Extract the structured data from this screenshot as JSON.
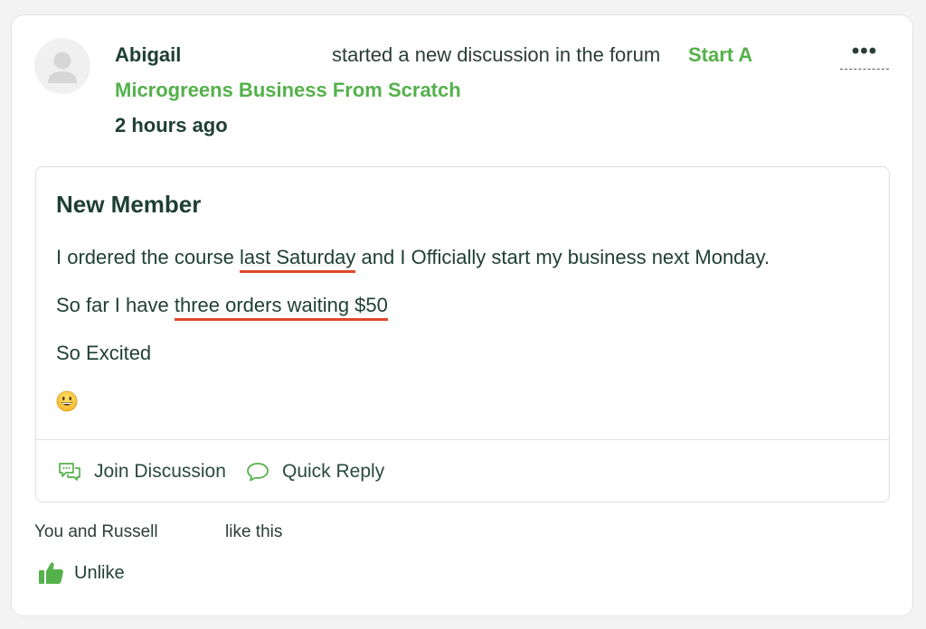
{
  "activity": {
    "author": "Abigail",
    "action_text": "started a new discussion in the forum",
    "forum_name_line1": "Start A",
    "forum_name_line2": "Microgreens Business From Scratch",
    "timestamp": "2 hours ago",
    "more_icon": "more-horizontal-icon"
  },
  "post": {
    "title": "New Member",
    "p1_before": "I ordered the course ",
    "p1_highlight": "last Saturday",
    "p1_after": " and I Officially start my business next Monday.",
    "p2_before": "So far I have ",
    "p2_highlight": "three orders waiting $50",
    "p3": "So Excited",
    "emoji": "grinning-face-emoji"
  },
  "post_actions": {
    "join_label": "Join Discussion",
    "quick_reply_label": "Quick Reply"
  },
  "likes": {
    "names": "You and Russell",
    "suffix": "like this",
    "unlike_label": "Unlike"
  },
  "colors": {
    "accent_green": "#54b14b",
    "text_dark_green": "#1e3f33",
    "highlight_underline": "#e2472b",
    "background": "#f3f3f3"
  }
}
